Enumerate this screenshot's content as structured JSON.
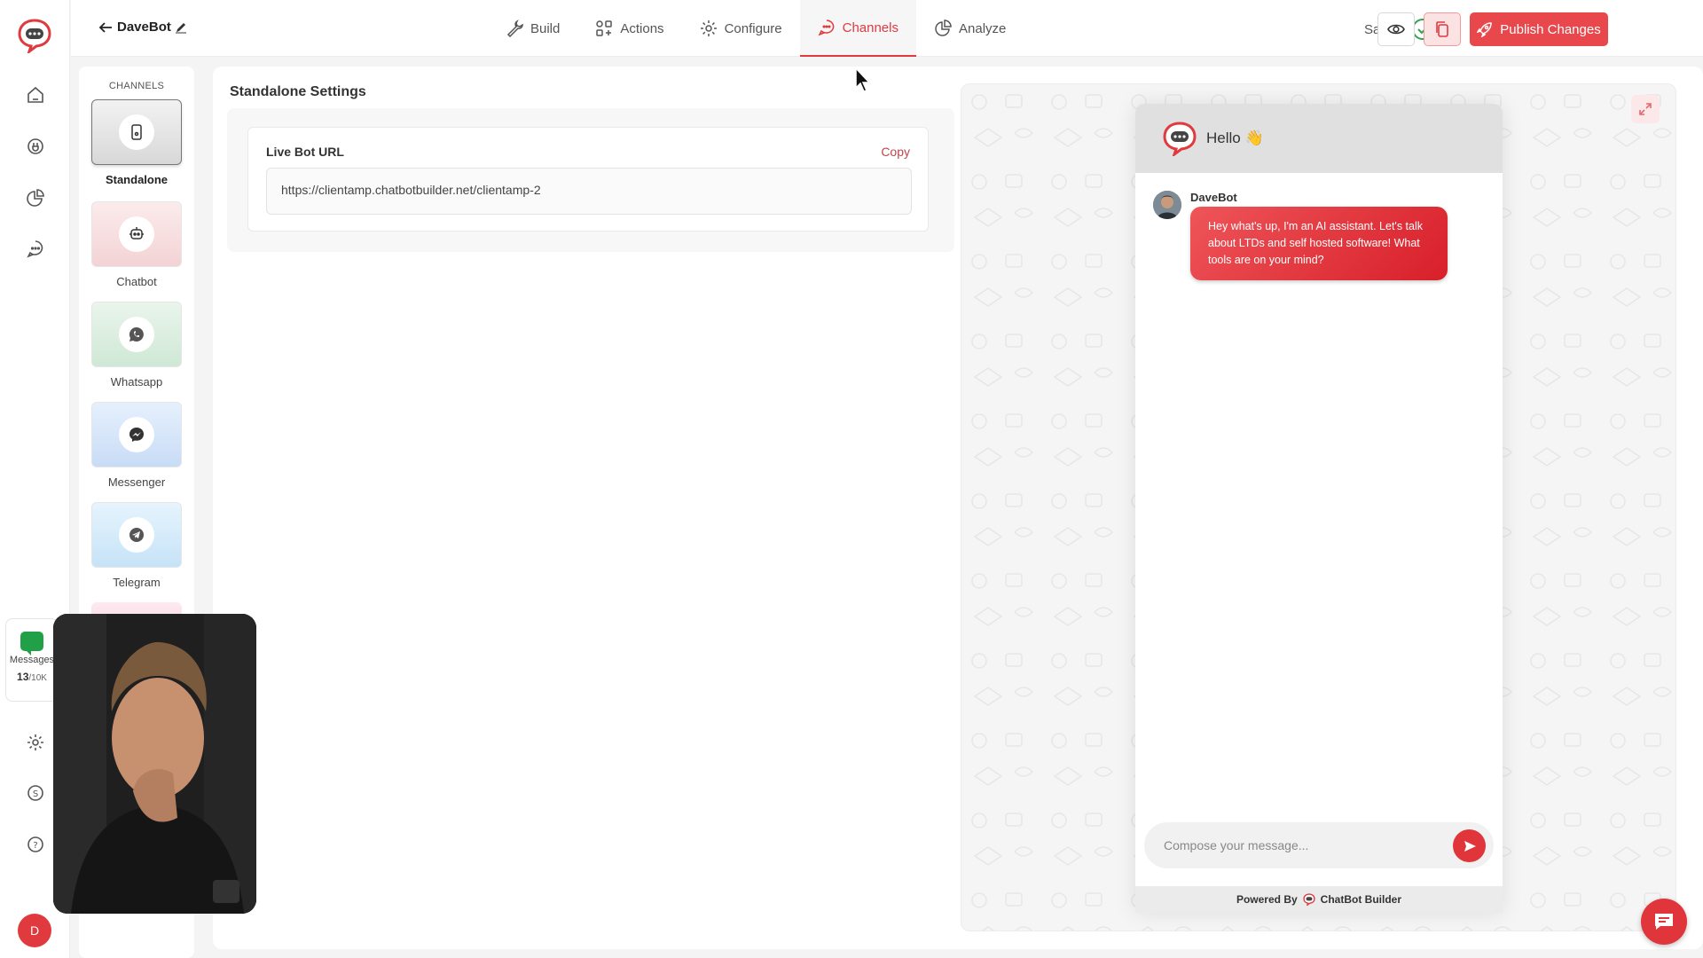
{
  "app": {
    "bot_name": "DaveBot"
  },
  "tabs": [
    {
      "label": "Build",
      "icon": "wrench-icon"
    },
    {
      "label": "Actions",
      "icon": "actions-icon"
    },
    {
      "label": "Configure",
      "icon": "gear-icon"
    },
    {
      "label": "Channels",
      "icon": "channels-icon",
      "active": true
    },
    {
      "label": "Analyze",
      "icon": "pie-chart-icon"
    }
  ],
  "status": {
    "saved": "Saved"
  },
  "publish_label": "Publish Changes",
  "sidebar": {
    "messages_label": "Messages",
    "messages_used": "13",
    "messages_limit": "/10K",
    "user_initial": "D"
  },
  "channels": {
    "header": "CHANNELS",
    "items": [
      {
        "label": "Standalone",
        "icon": "phone-icon",
        "selected": true
      },
      {
        "label": "Chatbot",
        "icon": "robot-icon"
      },
      {
        "label": "Whatsapp",
        "icon": "whatsapp-icon"
      },
      {
        "label": "Messenger",
        "icon": "messenger-icon"
      },
      {
        "label": "Telegram",
        "icon": "telegram-icon"
      }
    ]
  },
  "settings": {
    "title": "Standalone Settings",
    "url_label": "Live Bot URL",
    "copy_label": "Copy",
    "url_value": "https://clientamp.chatbotbuilder.net/clientamp-2"
  },
  "chat": {
    "greeting": "Hello 👋",
    "bot_name": "DaveBot",
    "message": "Hey what's up, I'm an AI assistant. Let's talk about LTDs and self hosted software! What tools are on your mind?",
    "compose_placeholder": "Compose your message...",
    "powered_by": "Powered By",
    "brand": "ChatBot Builder"
  },
  "colors": {
    "accent": "#e03a3f",
    "whatsapp_tile": "#dcefe0",
    "messenger_tile": "#d9e8fb",
    "telegram_tile": "#d6ecfa",
    "chatbot_tile": "#f7dfe0"
  }
}
